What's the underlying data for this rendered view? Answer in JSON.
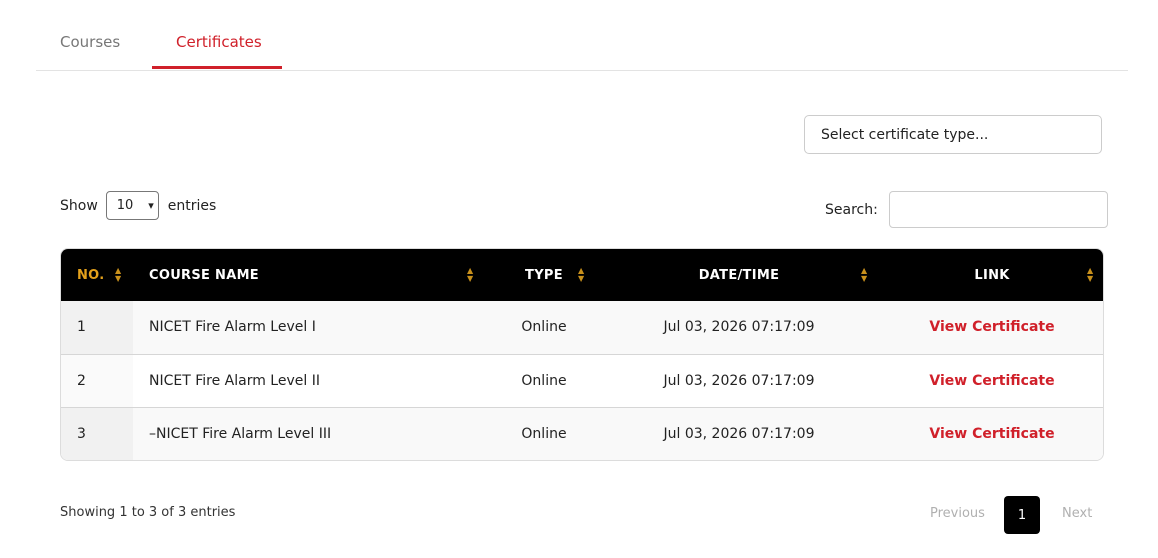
{
  "tabs": [
    {
      "label": "Courses",
      "active": false
    },
    {
      "label": "Certificates",
      "active": true
    }
  ],
  "certificate_type": {
    "placeholder": "Select certificate type..."
  },
  "length": {
    "show_label": "Show",
    "value": "10",
    "entries_label": "entries"
  },
  "search": {
    "label": "Search:",
    "value": ""
  },
  "table": {
    "headers": {
      "no": "No.",
      "course_name": "Course Name",
      "type": "Type",
      "datetime": "Date/Time",
      "link": "Link"
    },
    "rows": [
      {
        "no": "1",
        "course_name": "NICET Fire Alarm Level I",
        "type": "Online",
        "datetime": "Jul 03, 2026 07:17:09",
        "link": "View Certificate"
      },
      {
        "no": "2",
        "course_name": "NICET Fire Alarm Level II",
        "type": "Online",
        "datetime": "Jul 03, 2026 07:17:09",
        "link": "View Certificate"
      },
      {
        "no": "3",
        "course_name": "–NICET Fire Alarm Level III",
        "type": "Online",
        "datetime": "Jul 03, 2026 07:17:09",
        "link": "View Certificate"
      }
    ]
  },
  "info": "Showing 1 to 3 of 3 entries",
  "pagination": {
    "previous": "Previous",
    "current": "1",
    "next": "Next"
  },
  "colors": {
    "accent": "#d0202a",
    "header_bg": "#000000",
    "sort_icon": "#c8901c"
  }
}
